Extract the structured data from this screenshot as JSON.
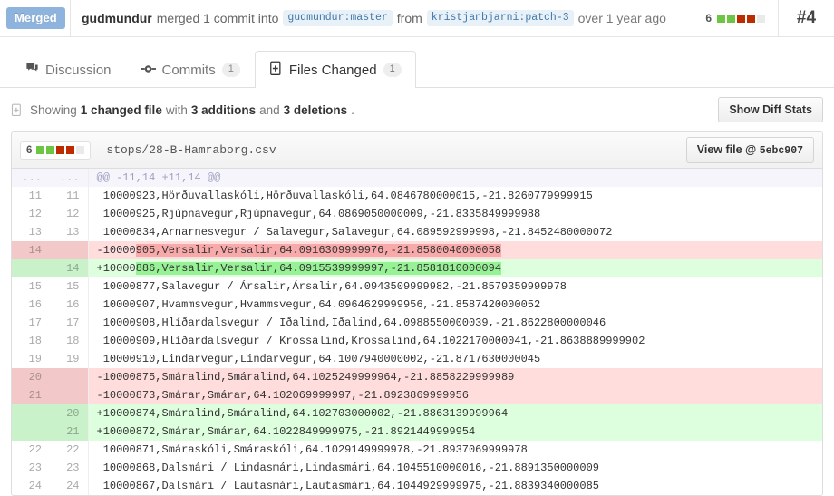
{
  "header": {
    "status_badge": "Merged",
    "actor": "gudmundur",
    "verb": "merged 1 commit into",
    "base_ref": "gudmundur:master",
    "from_word": "from",
    "head_ref": "kristjanbjarni:patch-3",
    "time": "over 1 year ago",
    "diffstat_count": "6",
    "diffstat_blocks": [
      "add",
      "add",
      "del",
      "del",
      "neu"
    ],
    "pr_number": "#4"
  },
  "tabs": [
    {
      "label": "Discussion",
      "icon": "comment-icon",
      "count": "",
      "active": false
    },
    {
      "label": "Commits",
      "icon": "commit-icon",
      "count": "1",
      "active": false
    },
    {
      "label": "Files Changed",
      "icon": "file-diff-icon",
      "count": "1",
      "active": true
    }
  ],
  "showing": {
    "icon": "file-diff-icon",
    "prefix": "Showing",
    "files": "1 changed file",
    "with": "with",
    "additions": "3 additions",
    "and": "and",
    "deletions": "3 deletions",
    "period": ".",
    "diff_stats_button": "Show Diff Stats"
  },
  "file": {
    "path": "stops/28-B-Hamraborg.csv",
    "stat_count": "6",
    "stat_blocks": [
      "add",
      "add",
      "del",
      "del",
      "neu"
    ],
    "view_file_label": "View file @",
    "view_file_sha": "5ebc907"
  },
  "diff": {
    "hunk_header": "@@ -11,14 +11,14 @@",
    "rows": [
      {
        "type": "hunk",
        "old": "...",
        "new": "...",
        "text": "@@ -11,14 +11,14 @@"
      },
      {
        "type": "ctx",
        "old": "11",
        "new": "11",
        "text": " 10000923,Hörðuvallaskóli,Hörðuvallaskóli,64.0846780000015,-21.8260779999915"
      },
      {
        "type": "ctx",
        "old": "12",
        "new": "12",
        "text": " 10000925,Rjúpnavegur,Rjúpnavegur,64.0869050000009,-21.8335849999988"
      },
      {
        "type": "ctx",
        "old": "13",
        "new": "13",
        "text": " 10000834,Arnarnesvegur / Salavegur,Salavegur,64.089592999998,-21.8452480000072"
      },
      {
        "type": "del",
        "old": "14",
        "new": "",
        "prefix": "-10000",
        "highlight": "905,Versalir,Versalir,64.0916309999976,-21.8580040000058"
      },
      {
        "type": "add",
        "old": "",
        "new": "14",
        "prefix": "+10000",
        "highlight": "886,Versalir,Versalir,64.0915539999997,-21.8581810000094"
      },
      {
        "type": "ctx",
        "old": "15",
        "new": "15",
        "text": " 10000877,Salavegur / Ársalir,Ársalir,64.0943509999982,-21.8579359999978"
      },
      {
        "type": "ctx",
        "old": "16",
        "new": "16",
        "text": " 10000907,Hvammsvegur,Hvammsvegur,64.0964629999956,-21.8587420000052"
      },
      {
        "type": "ctx",
        "old": "17",
        "new": "17",
        "text": " 10000908,Hlíðardalsvegur / Iðalind,Iðalind,64.0988550000039,-21.8622800000046"
      },
      {
        "type": "ctx",
        "old": "18",
        "new": "18",
        "text": " 10000909,Hlíðardalsvegur / Krossalind,Krossalind,64.1022170000041,-21.8638889999902"
      },
      {
        "type": "ctx",
        "old": "19",
        "new": "19",
        "text": " 10000910,Lindarvegur,Lindarvegur,64.1007940000002,-21.8717630000045"
      },
      {
        "type": "del",
        "old": "20",
        "new": "",
        "text": "-10000875,Smáralind,Smáralind,64.1025249999964,-21.8858229999989"
      },
      {
        "type": "del",
        "old": "21",
        "new": "",
        "text": "-10000873,Smárar,Smárar,64.102069999997,-21.8923869999956"
      },
      {
        "type": "add",
        "old": "",
        "new": "20",
        "text": "+10000874,Smáralind,Smáralind,64.102703000002,-21.8863139999964"
      },
      {
        "type": "add",
        "old": "",
        "new": "21",
        "text": "+10000872,Smárar,Smárar,64.1022849999975,-21.8921449999954"
      },
      {
        "type": "ctx",
        "old": "22",
        "new": "22",
        "text": " 10000871,Smáraskóli,Smáraskóli,64.1029149999978,-21.8937069999978"
      },
      {
        "type": "ctx",
        "old": "23",
        "new": "23",
        "text": " 10000868,Dalsmári / Lindasmári,Lindasmári,64.1045510000016,-21.8891350000009"
      },
      {
        "type": "ctx",
        "old": "24",
        "new": "24",
        "text": " 10000867,Dalsmári / Lautasmári,Lautasmári,64.1044929999975,-21.8839340000085"
      }
    ]
  },
  "colors": {
    "add_block": "#6cc644",
    "del_block": "#bd2c00",
    "neutral_block": "#eaeaea",
    "merged_badge": "#8eb4dd",
    "add_row": "#ddffdd",
    "del_row": "#ffdddd",
    "add_word": "#97f295",
    "del_word": "#f8a9a9"
  }
}
